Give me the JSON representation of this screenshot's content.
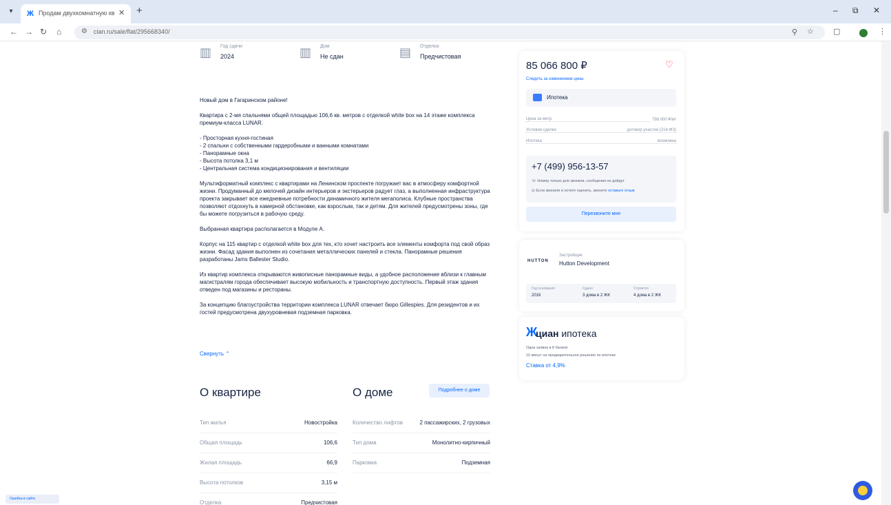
{
  "browser": {
    "tab_title": "Продам двухкомнатную квартиру",
    "url": "cian.ru/sale/flat/295668340/",
    "window_controls": [
      "–",
      "⧉",
      "✕"
    ]
  },
  "facts": [
    {
      "label": "Год сдачи",
      "value": "2024",
      "icon": "building-icon"
    },
    {
      "label": "Дом",
      "value": "Не сдан",
      "icon": "house-icon"
    },
    {
      "label": "Отделка",
      "value": "Предчистовая",
      "icon": "paint-roller-icon"
    }
  ],
  "description": {
    "intro": "Новый дом в Гагаринском районе!",
    "para1": "Квартира с 2-мя спальнями общей площадью 106,6 кв. метров с отделкой white box на 14 этаже комплекса премиум-класса LUNAR.",
    "list": [
      "- Просторная кухня-гостиная",
      "- 2 спальни с собственными гардеробными и ванными комнатами",
      "- Панорамные окна",
      "- Высота потолка 3,1 м",
      "- Центральная система кондиционирования и вентиляции"
    ],
    "para2": "懸Мультиформатный комплекс с квартирами на Ленинском проспекте погружает вас в атмосферу комфортной жизни. Продуманный до мелочей дизайн интерьеров и экстерьеров радует глаз, а выполненная инфраструктура проекта закрывает все ежедневные потребности динамичного жителя мегаполиса. Клубные пространства позволяют отдохнуть в камерной обстановке, как взрослым, так и детям. Для жителей предусмотрены зоны, где бы можете погрузиться в рабочую среду.",
    "para3": "Выбранная квартира располагается в Модуле А.",
    "para4": "Корпус на 115 квартир с отделкой white box для тех, кто хочет настроить все элементы комфорта под свой образ жизни. Фасад здания выполнен из сочетания металлических панелей и стекла. Панорамные решения разработаны Jams Ballester Studio.",
    "para5": "Из квартир комплекса открываются живописные панорамные виды, а удобное расположение вблизи к главным магистралям города обеспечивает высокую мобильность и транспортную доступность. Первый этаж здания отведен под магазины и рестораны.",
    "para6": "За концепцию благоустройства территории комплекса LUNAR отвечает бюро Gillespies. Для резидентов и их гостей предусмотрена двухуровневая подземная парковка.",
    "more": "Свернуть ⌃"
  },
  "about_flat": {
    "title": "О квартире",
    "rows": [
      {
        "k": "Тип жилья",
        "v": "Новостройка"
      },
      {
        "k": "Общая площадь",
        "v": "106,6"
      },
      {
        "k": "Жилая площадь",
        "v": "66,9"
      },
      {
        "k": "Высота потолков",
        "v": "3,15 м"
      },
      {
        "k": "Отделка",
        "v": "Предчистовая"
      }
    ]
  },
  "about_house": {
    "title": "О доме",
    "button": "Подробнее о доме",
    "rows": [
      {
        "k": "Количество лифтов",
        "v": "2 пассажирских, 2 грузовых"
      },
      {
        "k": "Тип дома",
        "v": "Монолитно-кирпичный"
      },
      {
        "k": "Парковка",
        "v": "Подземная"
      }
    ]
  },
  "price_card": {
    "price": "85 066 800 ₽",
    "price_link": "Следить за изменением цены",
    "mortgage": "Ипотека",
    "rows": [
      {
        "k": "Цена за метр",
        "v": "798 000 ₽/м²"
      },
      {
        "k": "Условия сделки",
        "v": "договор участия (214-ФЗ)"
      },
      {
        "k": "Ипотека",
        "v": "возможна"
      }
    ],
    "phone": "+7 (499) 956-13-57",
    "phone_note1": "Номер только для звонков, сообщения не дойдут",
    "phone_note2": "Если звонили и хотите оценить, звоните",
    "phone_note2_link": "оставьте отзыв",
    "write_button": "Перезвоните мне"
  },
  "developer": {
    "logo": "HUTTON",
    "subtitle": "Застройщик",
    "name": "Hutton Development",
    "stats": [
      {
        "k": "Год основания",
        "v": "2016"
      },
      {
        "k": "Сдано",
        "v": "3 дома в 2 ЖК"
      },
      {
        "k": "Строится",
        "v": "4 дома в 2 ЖК"
      }
    ]
  },
  "cian_mortgage": {
    "mark": "Ж",
    "brand": "циан",
    "product": "ипотека",
    "note1": "Одна заявка в 8 банков",
    "note2": "10 минут на предварительное решение по ипотеке",
    "rate": "Ставка от 4,9%"
  },
  "help_chip": "Ошибка в сайте"
}
